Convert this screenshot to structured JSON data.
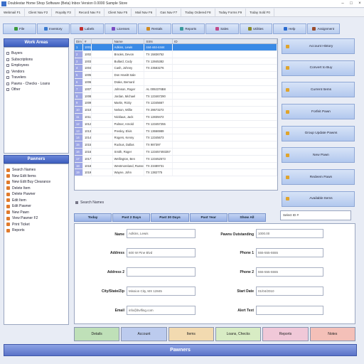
{
  "window": {
    "title": "Doublestar Home Shop Software (Beta) Inbox Version 0.0000 Sample Store",
    "controls": [
      "–",
      "□",
      "×"
    ]
  },
  "menu": [
    "Webmail F1",
    "Client Nav F2",
    "Royalty F3",
    "Record Nav F4",
    "Client Nav F5",
    "Mail Nav F6",
    "Gas Nav F7",
    "Today Ordered F8",
    "Today Forms F9",
    "Today Sold F0"
  ],
  "toolbar": [
    {
      "label": "File",
      "color": "#3a9a3a"
    },
    {
      "label": "Inventory",
      "color": "#3a7ad0"
    },
    {
      "label": "Labels",
      "color": "#c03030"
    },
    {
      "label": "Licenses",
      "color": "#7a4ac0"
    },
    {
      "label": "Rentals",
      "color": "#d08a20"
    },
    {
      "label": "Reports",
      "color": "#3a9a9a"
    },
    {
      "label": "Sales",
      "color": "#c04a8a"
    },
    {
      "label": "Utilities",
      "color": "#8a8a2a"
    },
    {
      "label": "Help",
      "color": "#2a6ad0"
    },
    {
      "label": "Assignment",
      "color": "#9a4a2a"
    }
  ],
  "work_areas": {
    "header": "Work Areas",
    "items": [
      "Buyers",
      "Subscriptions",
      "Employees",
      "Vendors",
      "Travelers",
      "Pawns - Checks - Loans",
      "Other"
    ]
  },
  "pawners": {
    "header": "Pawners",
    "items": [
      "Search Names",
      "New Edit Items",
      "New Edit Buy Clearance",
      "Delete Item",
      "Delete Pawner",
      "Edit Item",
      "Edit Pawner",
      "New Pawn",
      "View Pawner F2",
      "Print Ticket",
      "Reports"
    ]
  },
  "grid": {
    "columns": [
      "Dim",
      "#",
      "Name",
      "SSN",
      "ID"
    ],
    "rows": [
      {
        "n": "1",
        "c": "1001",
        "name": "Adkins, Lewis",
        "ssn": "444-444-4444",
        "sel": true
      },
      {
        "n": "2",
        "c": "1002",
        "name": "Brooks, Devon",
        "ssn": "TX 15836752",
        "sel": false
      },
      {
        "n": "3",
        "c": "1003",
        "name": "Bullard, Cody",
        "ssn": "TX 12845382",
        "sel": false
      },
      {
        "n": "4",
        "c": "1004",
        "name": "Cash, Johnny",
        "ssn": "TX 23583276",
        "sel": false
      },
      {
        "n": "5",
        "c": "1005",
        "name": "Don Hewitt Sale",
        "ssn": "",
        "sel": false
      },
      {
        "n": "6",
        "c": "1006",
        "name": "Drake, Bernard",
        "ssn": "",
        "sel": false
      },
      {
        "n": "7",
        "c": "1007",
        "name": "Johnson, Roger",
        "ssn": "AL 0092376B8",
        "sel": false
      },
      {
        "n": "8",
        "c": "1008",
        "name": "Jordan, Michael",
        "ssn": "TX 123467290",
        "sel": false
      },
      {
        "n": "9",
        "c": "1009",
        "name": "Martin, Ricky",
        "ssn": "TX 12345667",
        "sel": false
      },
      {
        "n": "10",
        "c": "1010",
        "name": "Nelson, Willie",
        "ssn": "TX 28673272",
        "sel": false
      },
      {
        "n": "11",
        "c": "1011",
        "name": "Nicklaus, Jack",
        "ssn": "TX 12839472",
        "sel": false
      },
      {
        "n": "12",
        "c": "1012",
        "name": "Palmer, Arnold",
        "ssn": "TX 123457255",
        "sel": false
      },
      {
        "n": "13",
        "c": "1013",
        "name": "Presley, Elvis",
        "ssn": "TX 13666989",
        "sel": false
      },
      {
        "n": "14",
        "c": "1014",
        "name": "Rogers, Kenny",
        "ssn": "TX 12345673",
        "sel": false
      },
      {
        "n": "15",
        "c": "1015",
        "name": "Ruckus, Dallas",
        "ssn": "TX 987397",
        "sel": false
      },
      {
        "n": "16",
        "c": "1016",
        "name": "Smith, Roger",
        "ssn": "TX 123457493257",
        "sel": false
      },
      {
        "n": "17",
        "c": "1017",
        "name": "Wellington, Ben",
        "ssn": "TX 123452573",
        "sel": false
      },
      {
        "n": "18",
        "c": "1018",
        "name": "Westmoreland, Russell",
        "ssn": "TX 23489731",
        "sel": false
      },
      {
        "n": "19",
        "c": "1019",
        "name": "Wayne, John",
        "ssn": "TX 1382775",
        "sel": false
      }
    ]
  },
  "search_names": "Search Names",
  "actions": [
    "Account History",
    "Convert to Buy",
    "Current Items",
    "Forfeit Pawn",
    "Group Update Pawns",
    "New Pawn",
    "Redeem Pawn",
    "Available Items"
  ],
  "filter_tabs": [
    "Today",
    "Past 2 Days",
    "Past 30 Days",
    "Past Year",
    "Show All"
  ],
  "selected_field": "Select ID #",
  "form": {
    "name_label": "Name",
    "name_value": "Adkins, Lewis",
    "address_label": "Address",
    "address_value": "600 W Pine Blvd",
    "address2_label": "Address 2",
    "address2_value": "",
    "city_label": "City/State/Zip",
    "city_value": "Mission City, MX 12845",
    "email_label": "Email",
    "email_value": "info@bvlfing.com",
    "pawns_label": "Pawns Outstanding",
    "pawns_value": "1000.00",
    "phone1_label": "Phone 1",
    "phone1_value": "555-555-5555",
    "phone2_label": "Phone 2",
    "phone2_value": "555-555-5555",
    "start_label": "Start Date",
    "start_value": "01/04/2010",
    "alert_label": "Alert Text",
    "alert_value": ""
  },
  "bottom_buttons": [
    {
      "label": "Details",
      "color": "#bfe0b8"
    },
    {
      "label": "Account",
      "color": "#bccbee"
    },
    {
      "label": "Items",
      "color": "#f2dab0"
    },
    {
      "label": "Loans, Checks",
      "color": "#d8ecc4"
    },
    {
      "label": "Reports",
      "color": "#f0c8d8"
    },
    {
      "label": "Notes",
      "color": "#f4c0b8"
    }
  ],
  "footer": "Pawners"
}
